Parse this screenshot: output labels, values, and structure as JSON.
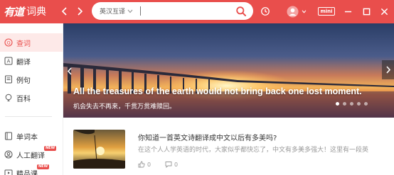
{
  "app": {
    "logo_mark": "有道",
    "logo_text": "词典"
  },
  "search": {
    "language": "英汉互译",
    "value": "",
    "placeholder": ""
  },
  "titlebar": {
    "mini_label": "mini"
  },
  "sidebar": {
    "items": [
      {
        "label": "查词"
      },
      {
        "label": "翻译"
      },
      {
        "label": "例句"
      },
      {
        "label": "百科"
      },
      {
        "label": "单词本"
      },
      {
        "label": "人工翻译",
        "badge": "NEW"
      },
      {
        "label": "精品课",
        "badge": "NEW"
      }
    ]
  },
  "banner": {
    "quote_en": "All the treasures of the earth would not bring back one lost moment.",
    "quote_zh": "机会失去不再来，千贯万贯难赎回。",
    "slide_count": 5,
    "active_slide": 1
  },
  "article": {
    "title": "你知道一首英文诗翻译成中文以后有多美吗?",
    "summary": "在这个人人学英语的时代，大家似乎都快忘了，中文有多美多强大！这里有一段英",
    "likes": "0",
    "comments": "0"
  },
  "colors": {
    "brand": "#e94e4c",
    "active_bg": "#fde9e8"
  }
}
